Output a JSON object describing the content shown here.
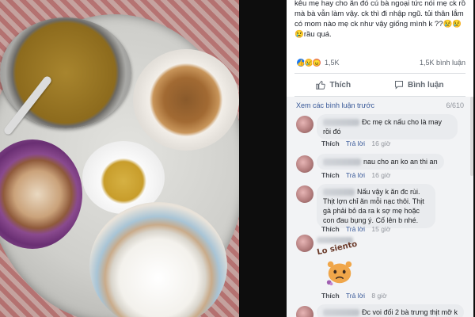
{
  "post": {
    "lines": [
      "kêu mẹ hay cho ăn đó cú bà ngoại tức nói mẹ ck rồi",
      "mà bà vẫn làm vậy. ck thì đi nhập ngũ. tủi thân lắm",
      "có mom nào mẹ ck như vậy giống mình k ??😢😢",
      "😢rầu quá."
    ]
  },
  "reactions": {
    "icons": [
      "like-icon",
      "sad-icon",
      "angry-icon"
    ],
    "count": "1,5K",
    "comments": "1,5K bình luận"
  },
  "actions": {
    "like_label": "Thích",
    "comment_label": "Bình luận"
  },
  "comments_header": {
    "view_previous": "Xem các bình luận trước",
    "page_count": "6/610"
  },
  "comments": [
    {
      "text": "Đc mẹ ck nấu cho là may rồi đó",
      "like": "Thích",
      "reply": "Trả lời",
      "time": "16 giờ"
    },
    {
      "text": "nau cho an ko an thi an",
      "like": "Thích",
      "reply": "Trả lời",
      "time": "16 giờ"
    },
    {
      "text": "Nấu vậy k ăn đc rùi. Thịt lợn chỉ ăn mỗi nạc thôi. Thịt gà phải bỏ da ra k sợ mẹ hoặc con đau bụng ý. Cố lên b nhé.",
      "like": "Thích",
      "reply": "Trả lời",
      "time": "15 giờ"
    },
    {
      "sticker_text": "Lo siento",
      "like": "Thích",
      "reply": "Trả lời",
      "time": "8 giờ"
    },
    {
      "text": "Đc voi đối 2 bà trưng thịt mỡ k",
      "like": "Thích",
      "reply": "Trả lời",
      "time": ""
    }
  ],
  "colors": {
    "facebook_blue": "#1877f2",
    "link": "#385898",
    "muted": "#90949c"
  }
}
